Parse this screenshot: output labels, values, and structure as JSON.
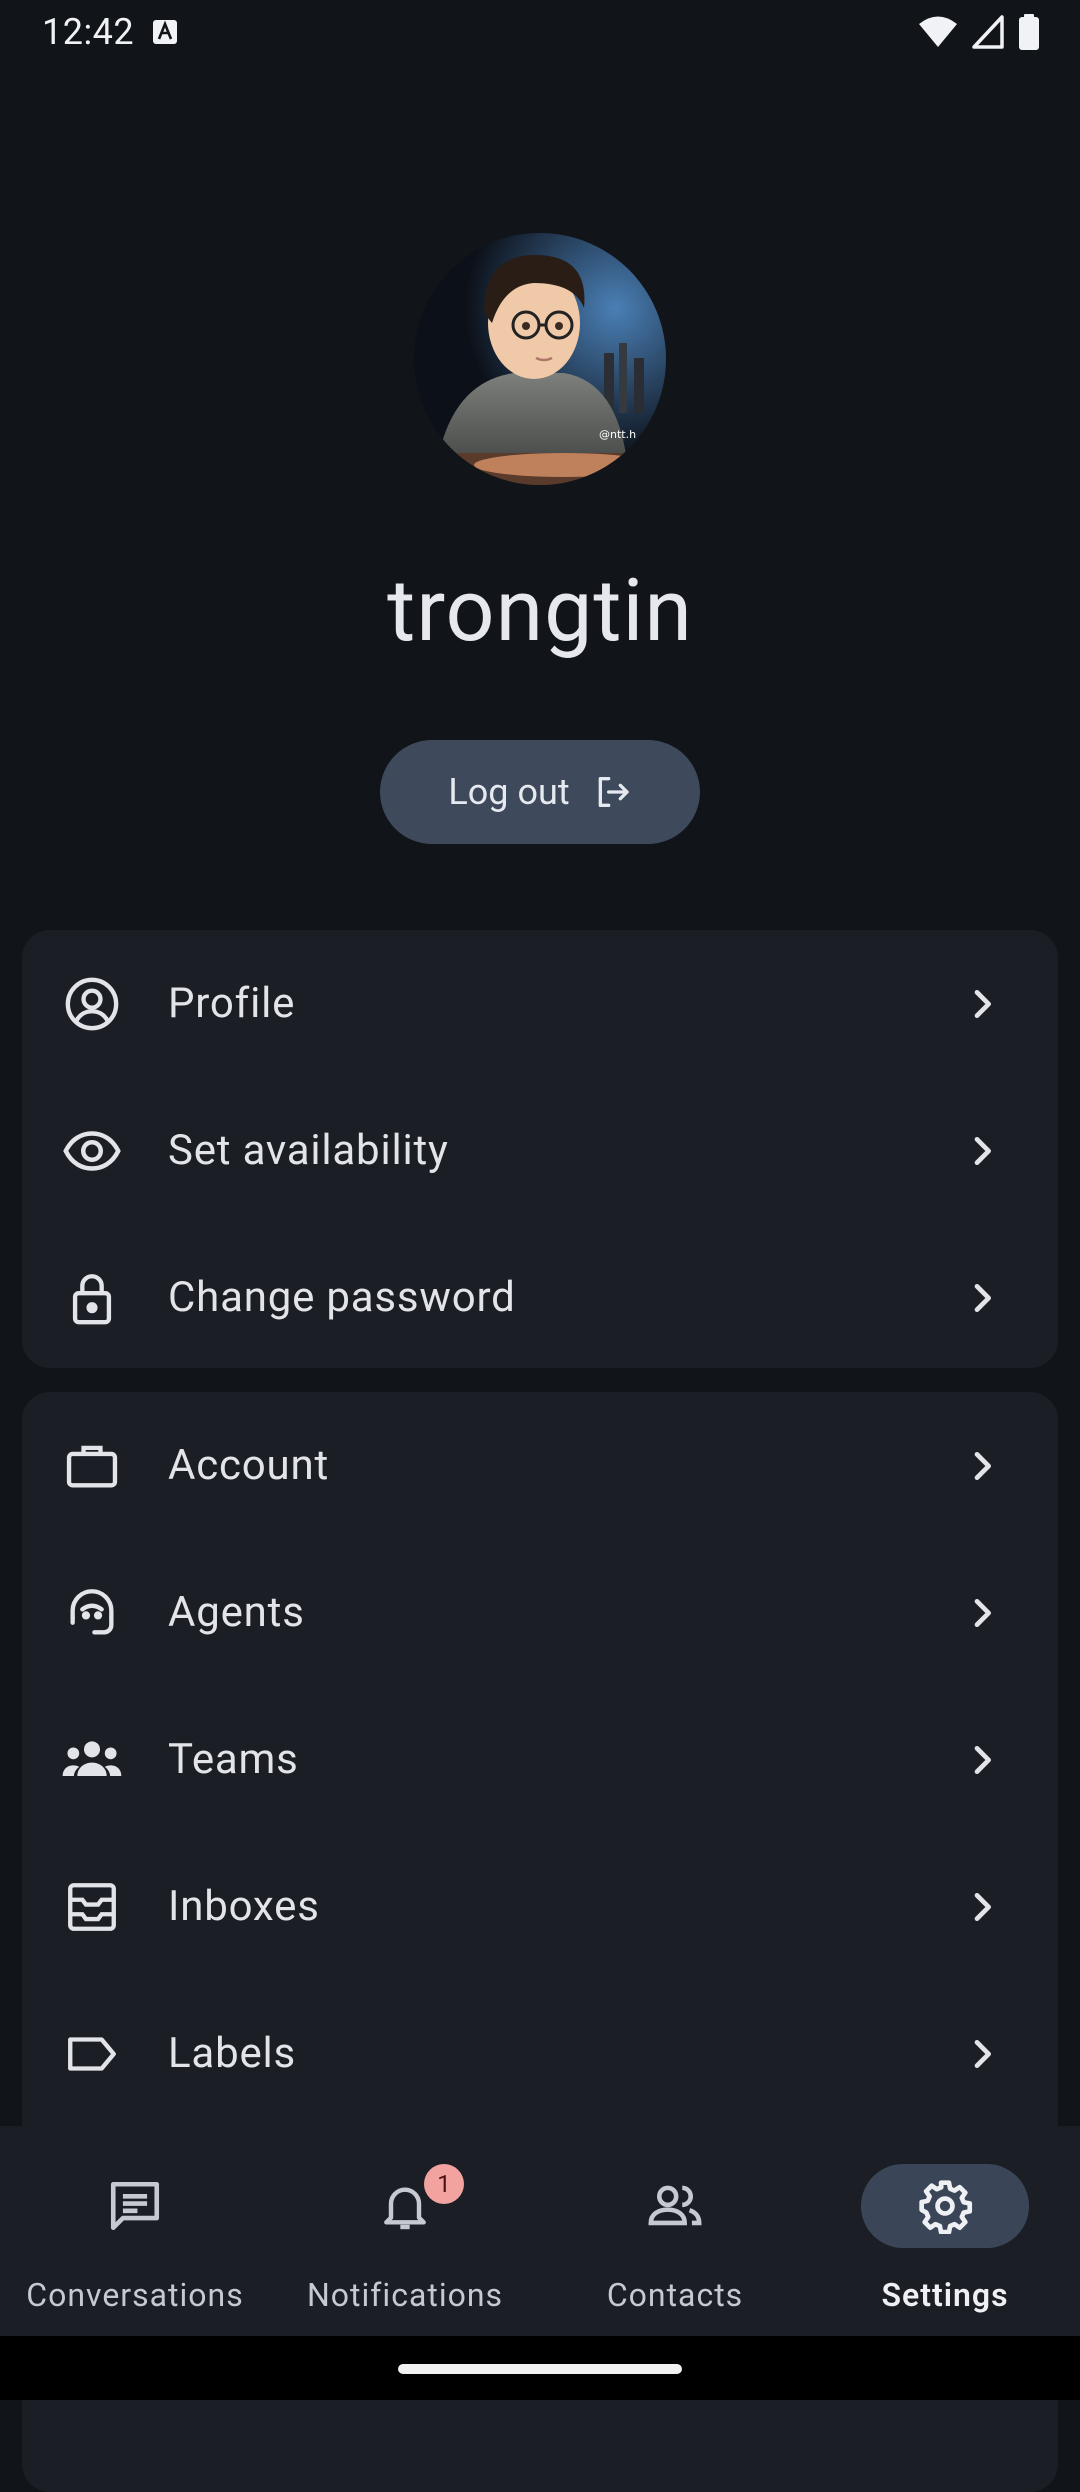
{
  "status_bar": {
    "time": "12:42",
    "icons": [
      "text-notification-icon",
      "wifi-icon",
      "signal-icon",
      "battery-icon"
    ]
  },
  "profile": {
    "username": "trongtin",
    "avatar": "avatar-illustration",
    "logout_label": "Log out"
  },
  "settings_groups": [
    {
      "items": [
        {
          "label": "Profile",
          "icon": "user-circle-icon"
        },
        {
          "label": "Set availability",
          "icon": "eye-icon"
        },
        {
          "label": "Change password",
          "icon": "lock-icon"
        }
      ]
    },
    {
      "items": [
        {
          "label": "Account",
          "icon": "briefcase-icon"
        },
        {
          "label": "Agents",
          "icon": "headset-agent-icon"
        },
        {
          "label": "Teams",
          "icon": "team-icon"
        },
        {
          "label": "Inboxes",
          "icon": "inbox-icon"
        },
        {
          "label": "Labels",
          "icon": "label-tag-icon"
        }
      ]
    }
  ],
  "bottom_nav": {
    "items": [
      {
        "label": "Conversations",
        "icon": "chat-icon",
        "active": false
      },
      {
        "label": "Notifications",
        "icon": "bell-icon",
        "active": false,
        "badge": "1"
      },
      {
        "label": "Contacts",
        "icon": "contacts-icon",
        "active": false
      },
      {
        "label": "Settings",
        "icon": "gear-icon",
        "active": true
      }
    ]
  },
  "colors": {
    "background": "#111419",
    "card": "#1b1e24",
    "button": "#3e4a5c",
    "active_pill": "#3a4658",
    "badge": "#f2a3a0"
  }
}
